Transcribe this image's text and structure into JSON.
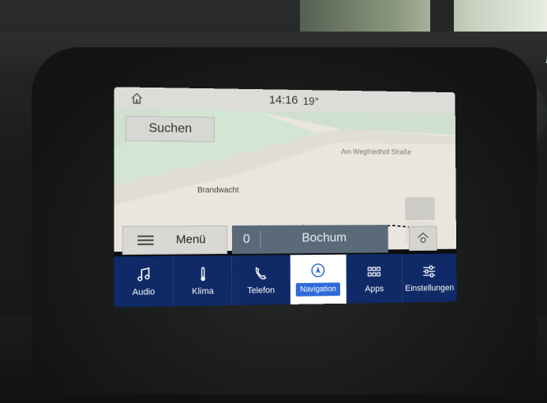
{
  "status": {
    "time": "14:16",
    "temperature": "19°"
  },
  "map": {
    "search_label": "Suchen",
    "street": "Am Wegfriedhof Straße",
    "place": "Brandwacht"
  },
  "menu": {
    "label": "Menü"
  },
  "destination": {
    "count": "0",
    "name": "Bochum"
  },
  "nav": {
    "items": [
      {
        "label": "Audio",
        "icon": "music-note-icon"
      },
      {
        "label": "Klima",
        "icon": "thermometer-icon"
      },
      {
        "label": "Telefon",
        "icon": "phone-icon"
      },
      {
        "label": "Navigation",
        "icon": "navigation-icon"
      },
      {
        "label": "Apps",
        "icon": "apps-grid-icon"
      },
      {
        "label": "Einstellungen",
        "icon": "settings-sliders-icon"
      }
    ],
    "active": "Navigation"
  },
  "colors": {
    "navbar": "#0f2a66",
    "active_badge": "#2f6bd8",
    "destination_bar": "#5a6a78",
    "route_marker": "#d2150f"
  }
}
